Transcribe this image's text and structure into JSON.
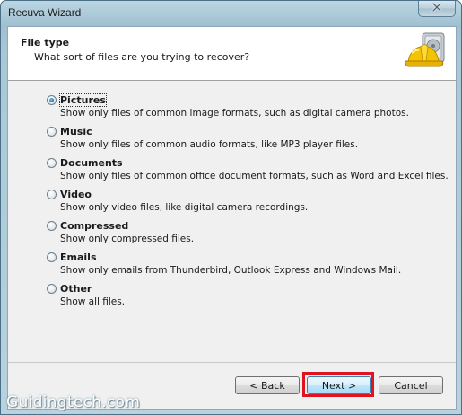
{
  "window": {
    "title": "Recuva Wizard",
    "close_glyph": "✕"
  },
  "header": {
    "title": "File type",
    "subtitle": "What sort of files are you trying to recover?",
    "logo_icon": "hard-hat-drive-icon"
  },
  "options": [
    {
      "label": "Pictures",
      "description": "Show only files of common image formats, such as digital camera photos.",
      "selected": true
    },
    {
      "label": "Music",
      "description": "Show only files of common audio formats, like MP3 player files.",
      "selected": false
    },
    {
      "label": "Documents",
      "description": "Show only files of common office document formats, such as Word and Excel files.",
      "selected": false
    },
    {
      "label": "Video",
      "description": "Show only video files, like digital camera recordings.",
      "selected": false
    },
    {
      "label": "Compressed",
      "description": "Show only compressed files.",
      "selected": false
    },
    {
      "label": "Emails",
      "description": "Show only emails from Thunderbird, Outlook Express and Windows Mail.",
      "selected": false
    },
    {
      "label": "Other",
      "description": "Show all files.",
      "selected": false
    }
  ],
  "buttons": {
    "back": "< Back",
    "next": "Next >",
    "cancel": "Cancel"
  },
  "watermark": "Guidingtech.com",
  "colors": {
    "highlight": "#e0141e",
    "window_frame": "#a9c8d6"
  }
}
